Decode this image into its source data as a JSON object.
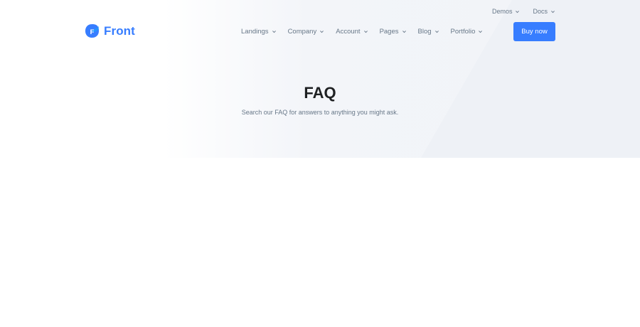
{
  "topbar": {
    "items": [
      {
        "label": "Demos",
        "icon": "chevron-down-icon"
      },
      {
        "label": "Docs",
        "icon": "chevron-down-icon"
      }
    ]
  },
  "logo": {
    "text": "Front",
    "icon": "front-logo-icon",
    "mark_letter": "F"
  },
  "nav": {
    "items": [
      {
        "label": "Landings"
      },
      {
        "label": "Company"
      },
      {
        "label": "Account"
      },
      {
        "label": "Pages"
      },
      {
        "label": "Blog"
      },
      {
        "label": "Portfolio"
      }
    ],
    "cta_label": "Buy now"
  },
  "hero": {
    "title": "FAQ",
    "subtitle": "Search our FAQ for answers to anything you might ask."
  },
  "colors": {
    "primary": "#377dff",
    "text_muted": "#677788",
    "heading": "#1e2022",
    "hero_bg": "#f1f4f8"
  }
}
